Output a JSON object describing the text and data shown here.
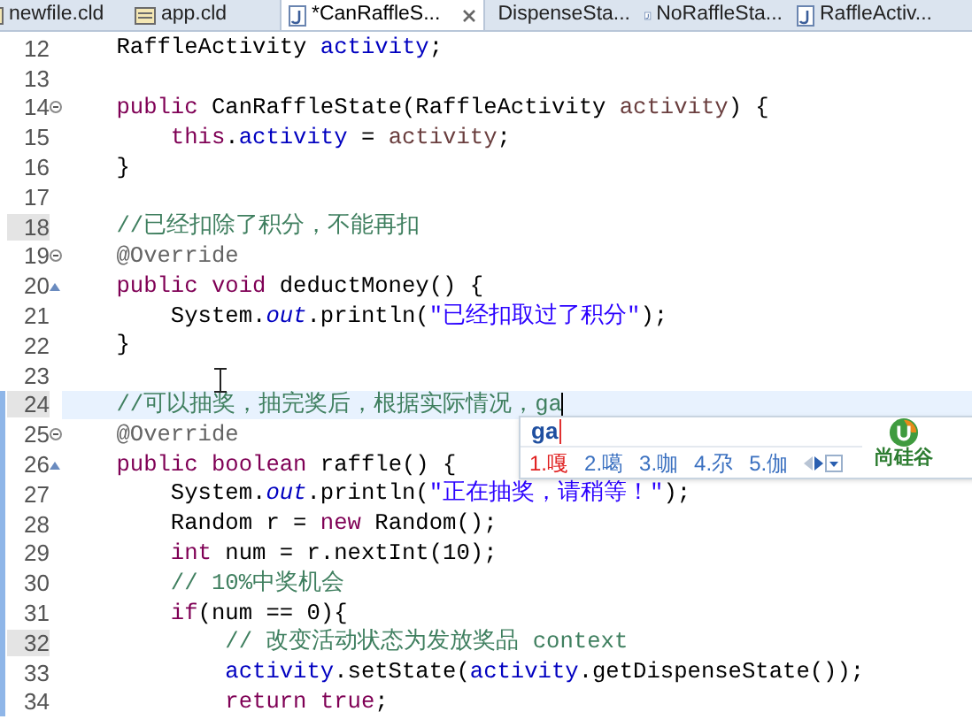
{
  "tabs": [
    {
      "label": "newfile.cld",
      "kind": "model",
      "selected": false
    },
    {
      "label": "app.cld",
      "kind": "model",
      "selected": false
    },
    {
      "label": "*CanRaffleS...",
      "kind": "java",
      "selected": true
    },
    {
      "label": "DispenseSta...",
      "kind": "java",
      "selected": false
    },
    {
      "label": "NoRaffleSta...",
      "kind": "java",
      "selected": false
    },
    {
      "label": "RaffleActiv...",
      "kind": "java",
      "selected": false
    }
  ],
  "editor": {
    "lines": [
      {
        "number": "12",
        "marked": false,
        "current": false,
        "changed": false,
        "fold": false,
        "override": false,
        "tokens": [
          {
            "kind": "plain",
            "text": "    RaffleActivity "
          },
          {
            "kind": "field",
            "text": "activity"
          },
          {
            "kind": "plain",
            "text": ";"
          }
        ]
      },
      {
        "number": "13",
        "marked": false,
        "current": false,
        "changed": false,
        "fold": false,
        "override": false
      },
      {
        "number": "14",
        "marked": false,
        "current": false,
        "changed": false,
        "fold": true,
        "override": false,
        "tokens": [
          {
            "kind": "kw",
            "text": "    public "
          },
          {
            "kind": "plain",
            "text": "CanRaffleState(RaffleActivity "
          },
          {
            "kind": "param",
            "text": "activity"
          },
          {
            "kind": "plain",
            "text": ") {"
          }
        ]
      },
      {
        "number": "15",
        "marked": false,
        "current": false,
        "changed": false,
        "fold": false,
        "override": false,
        "tokens": [
          {
            "kind": "kw",
            "text": "        this"
          },
          {
            "kind": "plain",
            "text": "."
          },
          {
            "kind": "field",
            "text": "activity"
          },
          {
            "kind": "plain",
            "text": " = "
          },
          {
            "kind": "param",
            "text": "activity"
          },
          {
            "kind": "plain",
            "text": ";"
          }
        ]
      },
      {
        "number": "16",
        "marked": false,
        "current": false,
        "changed": false,
        "fold": false,
        "override": false,
        "tokens": [
          {
            "kind": "plain",
            "text": "    }"
          }
        ]
      },
      {
        "number": "17",
        "marked": false,
        "current": false,
        "changed": false,
        "fold": false,
        "override": false
      },
      {
        "number": "18",
        "marked": true,
        "current": false,
        "changed": false,
        "fold": false,
        "override": false,
        "tokens": [
          {
            "kind": "comment",
            "text": "    //已经扣除了积分，不能再扣"
          }
        ]
      },
      {
        "number": "19",
        "marked": false,
        "current": false,
        "changed": false,
        "fold": true,
        "override": false,
        "tokens": [
          {
            "kind": "ann",
            "text": "    @Override"
          }
        ]
      },
      {
        "number": "20",
        "marked": false,
        "current": false,
        "changed": false,
        "fold": false,
        "override": true,
        "tokens": [
          {
            "kind": "kw",
            "text": "    public void "
          },
          {
            "kind": "plain",
            "text": "deductMoney() {"
          }
        ]
      },
      {
        "number": "21",
        "marked": false,
        "current": false,
        "changed": false,
        "fold": false,
        "override": false,
        "tokens": [
          {
            "kind": "plain",
            "text": "        System."
          },
          {
            "kind": "static",
            "text": "out"
          },
          {
            "kind": "plain",
            "text": ".println("
          },
          {
            "kind": "str",
            "text": "\"已经扣取过了积分\""
          },
          {
            "kind": "plain",
            "text": ");"
          }
        ]
      },
      {
        "number": "22",
        "marked": false,
        "current": false,
        "changed": false,
        "fold": false,
        "override": false,
        "tokens": [
          {
            "kind": "plain",
            "text": "    }"
          }
        ]
      },
      {
        "number": "23",
        "marked": false,
        "current": false,
        "changed": false,
        "fold": false,
        "override": false
      },
      {
        "number": "24",
        "marked": true,
        "current": true,
        "changed": true,
        "fold": false,
        "override": false,
        "tokens": [
          {
            "kind": "comment",
            "text": "    //可以抽奖，抽完奖后，根据实际情况，ga"
          }
        ]
      },
      {
        "number": "25",
        "marked": false,
        "current": false,
        "changed": true,
        "fold": true,
        "override": false,
        "tokens": [
          {
            "kind": "ann",
            "text": "    @Override"
          }
        ]
      },
      {
        "number": "26",
        "marked": false,
        "current": false,
        "changed": true,
        "fold": false,
        "override": true,
        "tokens": [
          {
            "kind": "kw",
            "text": "    public boolean "
          },
          {
            "kind": "plain",
            "text": "raffle() {"
          }
        ]
      },
      {
        "number": "27",
        "marked": false,
        "current": false,
        "changed": true,
        "fold": false,
        "override": false,
        "tokens": [
          {
            "kind": "plain",
            "text": "        System."
          },
          {
            "kind": "static",
            "text": "out"
          },
          {
            "kind": "plain",
            "text": ".println("
          },
          {
            "kind": "str",
            "text": "\"正在抽奖，请稍等！\""
          },
          {
            "kind": "plain",
            "text": ");"
          }
        ]
      },
      {
        "number": "28",
        "marked": false,
        "current": false,
        "changed": true,
        "fold": false,
        "override": false,
        "tokens": [
          {
            "kind": "plain",
            "text": "        Random r = "
          },
          {
            "kind": "kw",
            "text": "new "
          },
          {
            "kind": "plain",
            "text": "Random();"
          }
        ]
      },
      {
        "number": "29",
        "marked": false,
        "current": false,
        "changed": true,
        "fold": false,
        "override": false,
        "tokens": [
          {
            "kind": "kw",
            "text": "        int "
          },
          {
            "kind": "plain",
            "text": "num = r.nextInt(10);"
          }
        ]
      },
      {
        "number": "30",
        "marked": false,
        "current": false,
        "changed": true,
        "fold": false,
        "override": false,
        "tokens": [
          {
            "kind": "comment",
            "text": "        // 10%中奖机会"
          }
        ]
      },
      {
        "number": "31",
        "marked": false,
        "current": false,
        "changed": true,
        "fold": false,
        "override": false,
        "tokens": [
          {
            "kind": "kw",
            "text": "        if"
          },
          {
            "kind": "plain",
            "text": "(num == 0){"
          }
        ]
      },
      {
        "number": "32",
        "marked": true,
        "current": false,
        "changed": true,
        "fold": false,
        "override": false,
        "tokens": [
          {
            "kind": "comment",
            "text": "            // 改变活动状态为发放奖品 context"
          }
        ]
      },
      {
        "number": "33",
        "marked": false,
        "current": false,
        "changed": true,
        "fold": false,
        "override": false,
        "tokens": [
          {
            "kind": "field",
            "text": "            activity"
          },
          {
            "kind": "plain",
            "text": ".setState("
          },
          {
            "kind": "field",
            "text": "activity"
          },
          {
            "kind": "plain",
            "text": ".getDispenseState());"
          }
        ]
      },
      {
        "number": "34",
        "marked": false,
        "current": false,
        "changed": true,
        "fold": false,
        "override": false,
        "tokens": [
          {
            "kind": "kw",
            "text": "            return true"
          },
          {
            "kind": "plain",
            "text": ";"
          }
        ]
      }
    ]
  },
  "ime": {
    "composition": "ga",
    "candidates": [
      {
        "label": "1.嘎",
        "selected": true
      },
      {
        "label": "2.噶",
        "selected": false
      },
      {
        "label": "3.咖",
        "selected": false
      },
      {
        "label": "4.尕",
        "selected": false
      },
      {
        "label": "5.伽",
        "selected": false
      }
    ],
    "brand": "尚硅谷"
  }
}
